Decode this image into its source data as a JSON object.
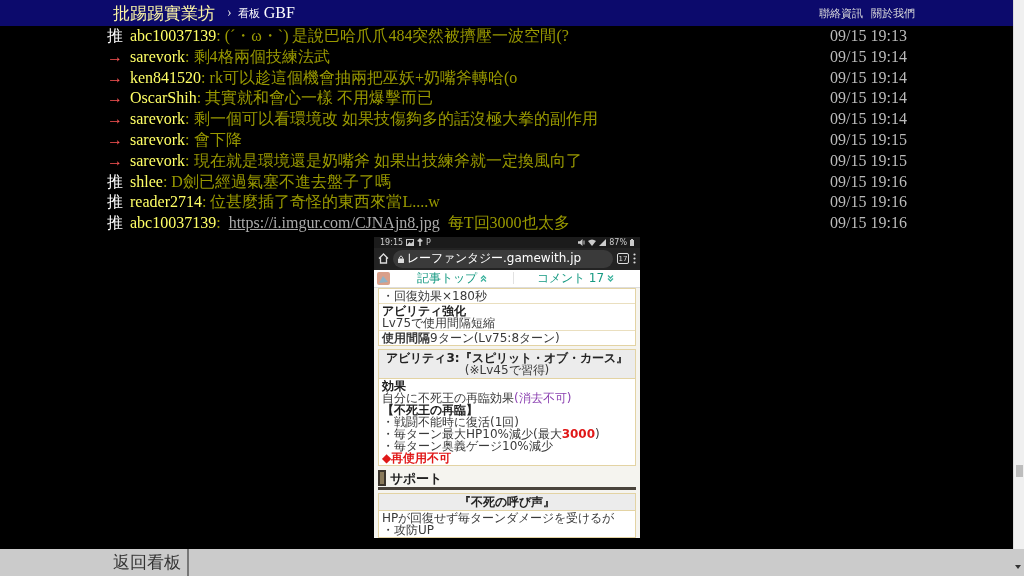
{
  "header": {
    "site_title": "批踢踢實業坊",
    "separator": "›",
    "board_label": "看板",
    "board_name": "GBF",
    "links": [
      "聯絡資訊",
      "關於我們"
    ]
  },
  "pushes": [
    {
      "kind": "push",
      "tag": "推",
      "user": "abc10037139",
      "content": [
        {
          "kind": "text",
          "text": ": (´・ω・`) 是說巴哈爪爪484突然被擠壓一波空間(?"
        }
      ],
      "time": "09/15 19:13"
    },
    {
      "kind": "arrow",
      "tag": "→",
      "user": "sarevork",
      "content": [
        {
          "kind": "text",
          "text": ": 剩4格兩個技練法武"
        }
      ],
      "time": "09/15 19:14"
    },
    {
      "kind": "arrow",
      "tag": "→",
      "user": "ken841520",
      "content": [
        {
          "kind": "text",
          "text": ": rk可以趁這個機會抽兩把巫妖+奶嘴斧轉哈(o"
        }
      ],
      "time": "09/15 19:14"
    },
    {
      "kind": "arrow",
      "tag": "→",
      "user": "OscarShih",
      "content": [
        {
          "kind": "text",
          "text": ": 其實就和會心一樣 不用爆擊而已"
        }
      ],
      "time": "09/15 19:14"
    },
    {
      "kind": "arrow",
      "tag": "→",
      "user": "sarevork",
      "content": [
        {
          "kind": "text",
          "text": ": 剩一個可以看環境改 如果技傷夠多的話沒極大拳的副作用"
        }
      ],
      "time": "09/15 19:14"
    },
    {
      "kind": "arrow",
      "tag": "→",
      "user": "sarevork",
      "content": [
        {
          "kind": "text",
          "text": ": 會下降"
        }
      ],
      "time": "09/15 19:15"
    },
    {
      "kind": "arrow",
      "tag": "→",
      "user": "sarevork",
      "content": [
        {
          "kind": "text",
          "text": ": 現在就是環境還是奶嘴斧 如果出技練斧就一定換風向了"
        }
      ],
      "time": "09/15 19:15"
    },
    {
      "kind": "push",
      "tag": "推",
      "user": "shlee",
      "content": [
        {
          "kind": "text",
          "text": ": D劍已經過氣塞不進去盤子了嗎"
        }
      ],
      "time": "09/15 19:16"
    },
    {
      "kind": "push",
      "tag": "推",
      "user": "reader2714",
      "content": [
        {
          "kind": "text",
          "text": ": 位甚麼插了奇怪的東西來當L....w"
        }
      ],
      "time": "09/15 19:16"
    },
    {
      "kind": "push",
      "tag": "推",
      "user": "abc10037139",
      "content": [
        {
          "kind": "text",
          "text": ":"
        },
        {
          "kind": "link",
          "text": "https://i.imgur.com/CJNAjn8.jpg"
        },
        {
          "kind": "text",
          "text": "每T回3000也太多"
        }
      ],
      "time": "09/15 19:16"
    }
  ],
  "image": {
    "status_bar": {
      "time": "19:15",
      "indicator": "P",
      "battery": "87%"
    },
    "browser": {
      "url": "レーファンタジー.gamewith.jp",
      "tab_count": "17"
    },
    "tabs": [
      "記事トップ",
      "コメント 17"
    ],
    "sections": [
      {
        "kind": "card",
        "rows": [
          [
            {
              "kind": "body",
              "segments": [
                {
                  "kind": "plain",
                  "text": "・回復効果×180秒"
                }
              ]
            }
          ],
          [
            {
              "kind": "label",
              "segments": [
                {
                  "kind": "plain",
                  "text": "アビリティ強化"
                }
              ]
            },
            {
              "kind": "body",
              "segments": [
                {
                  "kind": "plain",
                  "text": "Lv75で使用間隔短縮"
                }
              ]
            }
          ],
          [
            {
              "kind": "body",
              "segments": [
                {
                  "kind": "plain",
                  "text": "**使用間隔**9ターン(Lv75:8ターン)"
                }
              ]
            }
          ]
        ]
      },
      {
        "kind": "card",
        "header": [
          {
            "kind": "label",
            "segments": [
              {
                "kind": "plain",
                "text": "アビリティ3:『スピリット・オブ・カース』"
              }
            ]
          },
          {
            "kind": "body",
            "segments": [
              {
                "kind": "plain",
                "text": "(※Lv45で習得)"
              }
            ]
          }
        ],
        "rows": [
          [
            {
              "kind": "label",
              "segments": [
                {
                  "kind": "plain",
                  "text": "効果"
                }
              ]
            },
            {
              "kind": "body",
              "segments": [
                {
                  "kind": "plain",
                  "text": "自分に不死王の再臨効果"
                },
                {
                  "kind": "note",
                  "text": "(消去不可)"
                }
              ]
            },
            {
              "kind": "label",
              "segments": [
                {
                  "kind": "plain",
                  "text": "【不死王の再臨】"
                }
              ]
            },
            {
              "kind": "body",
              "segments": [
                {
                  "kind": "plain",
                  "text": "・戦闘不能時に復活(1回)"
                }
              ]
            },
            {
              "kind": "body",
              "segments": [
                {
                  "kind": "plain",
                  "text": "・毎ターン最大HP10%減少(最大"
                },
                {
                  "kind": "alert",
                  "text": "3000"
                },
                {
                  "kind": "plain",
                  "text": ")"
                }
              ]
            },
            {
              "kind": "body",
              "segments": [
                {
                  "kind": "plain",
                  "text": "・毎ターン奥義ゲージ10%減少"
                }
              ]
            },
            {
              "kind": "body",
              "segments": [
                {
                  "kind": "alert",
                  "text": "◆再使用不可"
                }
              ]
            }
          ]
        ]
      },
      {
        "kind": "section",
        "title": "サポート"
      },
      {
        "kind": "card",
        "header": [
          {
            "kind": "label",
            "segments": [
              {
                "kind": "plain",
                "text": "『不死の呼び声』"
              }
            ]
          }
        ],
        "rows": [
          [
            {
              "kind": "body",
              "segments": [
                {
                  "kind": "plain",
                  "text": "HPが回復せず毎ターンダメージを受けるが"
                }
              ]
            },
            {
              "kind": "body",
              "segments": [
                {
                  "kind": "plain",
                  "text": "・攻防UP"
                }
              ]
            }
          ]
        ]
      }
    ]
  },
  "footer": {
    "back_label": "返回看板"
  }
}
